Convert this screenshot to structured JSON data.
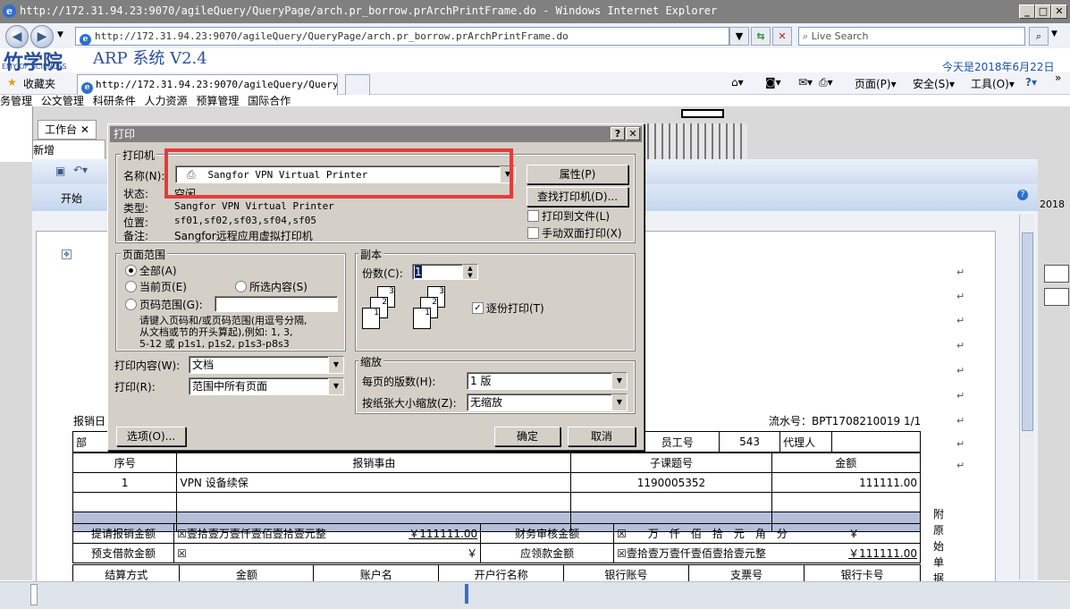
{
  "window": {
    "title": "http://172.31.94.23:9070/agileQuery/QueryPage/arch.pr_borrow.prArchPrintFrame.do - Windows Internet Explorer"
  },
  "address": {
    "url": "http://172.31.94.23:9070/agileQuery/QueryPage/arch.pr_borrow.prArchPrintFrame.do",
    "search_placeholder": "Live Search"
  },
  "banner": {
    "logo_text": "ARP 系统 V2.4",
    "academy_text": "EMY OF SCIENCES",
    "date_text": "今天是2018年6月22日"
  },
  "favorites": {
    "label": "收藏夹",
    "tab_label": "http://172.31.94.23:9070/agileQuery/Query..."
  },
  "tools": {
    "page": "页面(P)",
    "safety": "安全(S)",
    "tools": "工具(O)"
  },
  "app_menu": [
    "务管理",
    "公文管理",
    "科研条件",
    "人力资源",
    "预算管理",
    "国际合作"
  ],
  "app_tabs": {
    "worktab": "工作台",
    "new": "新增"
  },
  "ribbon": {
    "start": "开始",
    "date_fragment": "2018"
  },
  "report": {
    "left_label": "报销日",
    "serial": "流水号：BPT1708210019 1/1",
    "row1": {
      "dept": "部",
      "emp_label": "员工号",
      "emp_value": "543",
      "agent": "代理人"
    },
    "headers": {
      "no": "序号",
      "reason": "报销事由",
      "subject": "子课题号",
      "amount": "金额"
    },
    "line1": {
      "no": "1",
      "reason": "VPN 设备续保",
      "subject": "1190005352",
      "amount": "111111.00"
    },
    "apply": {
      "label": "提请报销金额",
      "text": "☒壹拾壹万壹仟壹佰壹拾壹元整",
      "amount": "￥111111.00",
      "audit_label": "财务审核金额",
      "audit_text": "☒　　万　仟　佰　拾　元　角　分",
      "audit_yen": "￥"
    },
    "advance": {
      "label": "预支借款金额",
      "text": "☒",
      "yen": "￥",
      "receive_label": "应领款金额",
      "receive_text": "☒壹拾壹万壹仟壹佰壹拾壹元整",
      "receive_amount": "￥111111.00"
    },
    "settle": {
      "method": "结算方式",
      "amount": "金额",
      "account_name": "账户名",
      "bank": "开户行名称",
      "bank_acct": "银行账号",
      "cheque": "支票号",
      "card": "银行卡号"
    },
    "side_note": [
      "附",
      "原",
      "始",
      "单",
      "据"
    ]
  },
  "dialog": {
    "title": "打印",
    "help": "?",
    "printer_group": "打印机",
    "name_label": "名称(N):",
    "printer_name": "Sangfor VPN Virtual Printer",
    "status_label": "状态:",
    "status_value": "空闲",
    "type_label": "类型:",
    "type_value": "Sangfor VPN Virtual Printer",
    "where_label": "位置:",
    "where_value": "sf01,sf02,sf03,sf04,sf05",
    "comment_label": "备注:",
    "comment_value": "Sangfor远程应用虚拟打印机",
    "properties_btn": "属性(P)",
    "find_printer_btn": "查找打印机(D)...",
    "print_to_file": "打印到文件(L)",
    "manual_duplex": "手动双面打印(X)",
    "range_group": "页面范围",
    "range_all": "全部(A)",
    "range_current": "当前页(E)",
    "range_selection": "所选内容(S)",
    "range_pages": "页码范围(G):",
    "range_hint1": "请键入页码和/或页码范围(用逗号分隔,",
    "range_hint2": "从文档或节的开头算起),例如: 1, 3,",
    "range_hint3": "5-12 或 p1s1, p1s2, p1s3-p8s3",
    "copies_group": "副本",
    "copies_label": "份数(C):",
    "copies_value": "1",
    "collate": "逐份打印(T)",
    "print_what_label": "打印内容(W):",
    "print_what_value": "文档",
    "print_label": "打印(R):",
    "print_value": "范围中所有页面",
    "zoom_group": "缩放",
    "pages_per_sheet_label": "每页的版数(H):",
    "pages_per_sheet_value": "1 版",
    "scale_label": "按纸张大小缩放(Z):",
    "scale_value": "无缩放",
    "options_btn": "选项(O)...",
    "ok_btn": "确定",
    "cancel_btn": "取消"
  }
}
